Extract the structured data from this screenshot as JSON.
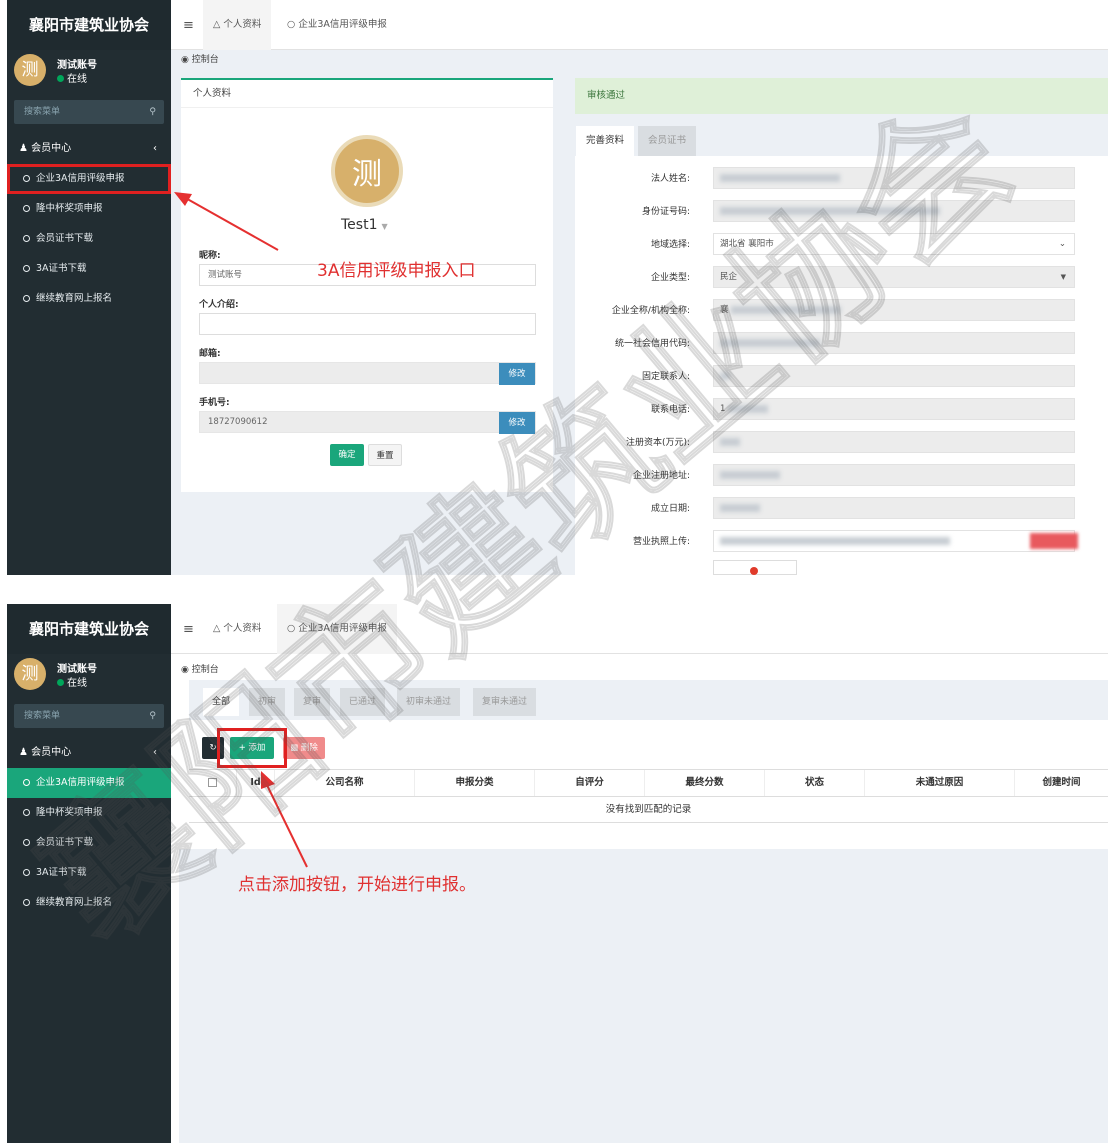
{
  "sidebar": {
    "app_title": "襄阳市建筑业协会",
    "avatar_char": "测",
    "user_name": "测试账号",
    "user_status": "在线",
    "search_placeholder": "搜索菜单",
    "group_label": "会员中心",
    "items": [
      {
        "label": "企业3A信用评级申报"
      },
      {
        "label": "隆中杯奖项申报"
      },
      {
        "label": "会员证书下载"
      },
      {
        "label": "3A证书下载"
      },
      {
        "label": "继续教育网上报名"
      }
    ]
  },
  "topbar": {
    "tab_profile": "个人资料",
    "tab_rating": "企业3A信用评级申报"
  },
  "breadcrumb": "控制台",
  "profile": {
    "card_title": "个人资料",
    "avatar_char": "测",
    "display_name": "Test1",
    "nickname_label": "昵称:",
    "nickname_value": "测试账号",
    "intro_label": "个人介绍:",
    "email_label": "邮箱:",
    "phone_label": "手机号:",
    "phone_value": "18727090612",
    "modify_label": "修改",
    "confirm_label": "确定",
    "reset_label": "重置"
  },
  "annotation1": "3A信用评级申报入口",
  "annotation2": "点击添加按钮，开始进行申报。",
  "review": {
    "status_text": "审核通过",
    "tab_complete": "完善资料",
    "tab_cert": "会员证书",
    "fields": [
      {
        "label": "法人姓名:",
        "value": ""
      },
      {
        "label": "身份证号码:",
        "value": ""
      },
      {
        "label": "地域选择:",
        "value": "湖北省  襄阳市"
      },
      {
        "label": "企业类型:",
        "value": "民企"
      },
      {
        "label": "企业全称/机构全称:",
        "value": "襄"
      },
      {
        "label": "统一社会信用代码:",
        "value": ""
      },
      {
        "label": "固定联系人:",
        "value": ""
      },
      {
        "label": "联系电话:",
        "value": "1"
      },
      {
        "label": "注册资本(万元):",
        "value": ""
      },
      {
        "label": "企业注册地址:",
        "value": ""
      },
      {
        "label": "成立日期:",
        "value": ""
      },
      {
        "label": "营业执照上传:",
        "value": ""
      }
    ]
  },
  "list": {
    "filters": [
      "全部",
      "初审",
      "复审",
      "已通过",
      "初审未通过",
      "复审未通过"
    ],
    "refresh_icon": "refresh-icon",
    "add_label": "+ 添加",
    "delete_label": "删除",
    "columns": [
      "Id",
      "公司名称",
      "申报分类",
      "自评分",
      "最终分数",
      "状态",
      "未通过原因",
      "创建时间"
    ],
    "empty_text": "没有找到匹配的记录"
  },
  "watermark": "襄阳市建筑业协会"
}
